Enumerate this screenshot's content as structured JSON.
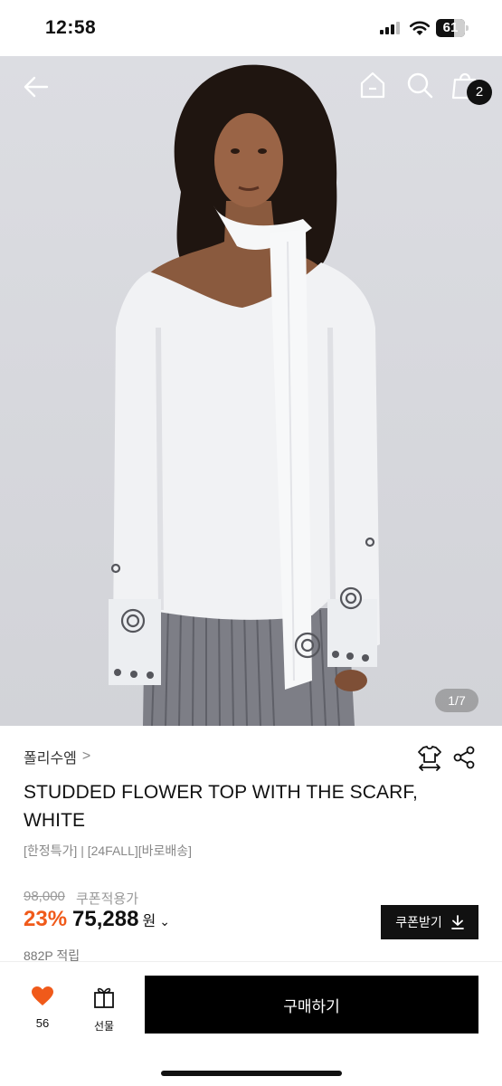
{
  "status_bar": {
    "time": "12:58",
    "battery": "61"
  },
  "hero": {
    "pager": "1/7",
    "cart_count": "2",
    "icons": [
      "back-arrow-icon",
      "home-icon",
      "search-icon",
      "shopping-bag-icon"
    ]
  },
  "product": {
    "brand": "폴리수엠",
    "brand_chevron": ">",
    "title": "STUDDED FLOWER TOP WITH THE SCARF, WHITE",
    "tags": "[한정특가] | [24FALL][바로배송]",
    "original_price": "98,000",
    "coupon_note": "쿠폰적용가",
    "discount": "23%",
    "final_price": "75,288",
    "currency": "원",
    "price_chevron": "⌄",
    "coupon_button": "쿠폰받기",
    "points": "882P 적립"
  },
  "bottom_bar": {
    "like_count": "56",
    "gift_label": "선물",
    "buy_label": "구매하기"
  },
  "colors": {
    "accent": "#f05a1a",
    "primary": "#000000",
    "muted": "#888888"
  }
}
